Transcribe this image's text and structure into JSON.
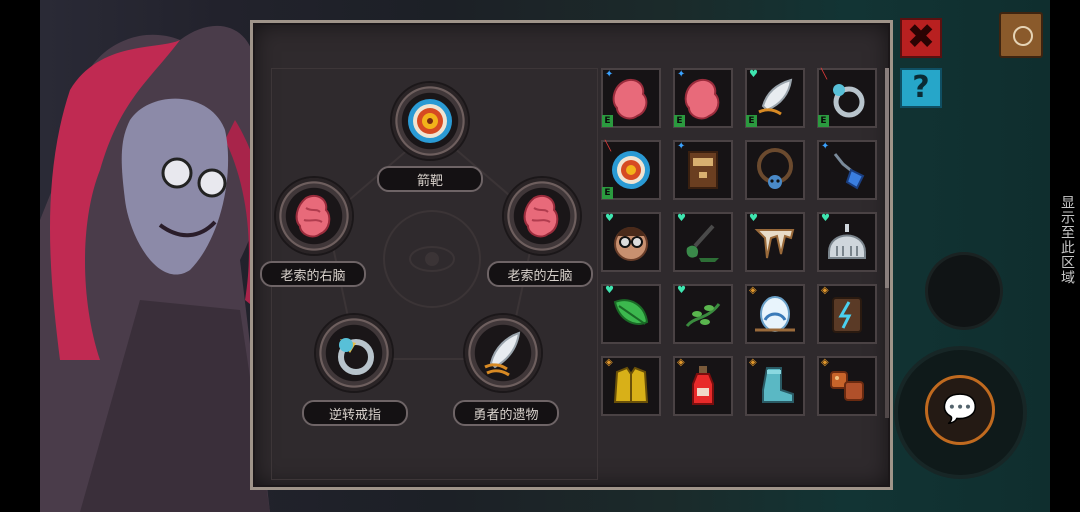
{
  "equipment": {
    "top": {
      "label": "箭靶",
      "icon": "target-icon"
    },
    "right_brain": {
      "label": "老索的右脑",
      "icon": "brain-icon"
    },
    "left_brain": {
      "label": "老索的左脑",
      "icon": "brain-icon"
    },
    "ring": {
      "label": "逆转戒指",
      "icon": "ring-icon"
    },
    "relic": {
      "label": "勇者的遗物",
      "icon": "feather-relic-icon"
    }
  },
  "inventory": [
    {
      "icon": "brain-icon",
      "marker": "star",
      "tag": "E"
    },
    {
      "icon": "brain-icon",
      "marker": "star",
      "tag": "E"
    },
    {
      "icon": "feather-relic-icon",
      "marker": "heart",
      "tag": "E"
    },
    {
      "icon": "ring-icon",
      "marker": "slash",
      "tag": "E"
    },
    {
      "icon": "target-icon",
      "marker": "slash",
      "tag": "E"
    },
    {
      "icon": "scroll-box-icon",
      "marker": "star",
      "tag": ""
    },
    {
      "icon": "skull-necklace-icon",
      "marker": "",
      "tag": ""
    },
    {
      "icon": "blue-amulet-icon",
      "marker": "star",
      "tag": ""
    },
    {
      "icon": "glasses-face-icon",
      "marker": "heart",
      "tag": ""
    },
    {
      "icon": "shovel-icon",
      "marker": "heart",
      "tag": ""
    },
    {
      "icon": "bone-fang-icon",
      "marker": "heart",
      "tag": ""
    },
    {
      "icon": "silver-helmet-icon",
      "marker": "heart",
      "tag": ""
    },
    {
      "icon": "green-leaf-icon",
      "marker": "heart",
      "tag": ""
    },
    {
      "icon": "vine-sprout-icon",
      "marker": "heart",
      "tag": ""
    },
    {
      "icon": "crystal-egg-icon",
      "marker": "shield",
      "tag": ""
    },
    {
      "icon": "lightning-rune-icon",
      "marker": "shield",
      "tag": ""
    },
    {
      "icon": "gold-armor-icon",
      "marker": "shield",
      "tag": ""
    },
    {
      "icon": "red-potion-icon",
      "marker": "shield",
      "tag": ""
    },
    {
      "icon": "teal-boot-icon",
      "marker": "shield",
      "tag": ""
    },
    {
      "icon": "meat-chunks-icon",
      "marker": "shield",
      "tag": ""
    }
  ],
  "buttons": {
    "close_glyph": "✖",
    "help_glyph": "?",
    "chat_glyph": "💬"
  },
  "side_text": "显示至此区域",
  "colors": {
    "panel_border": "#9f9489",
    "panel_bg": "#2f2a2d",
    "close_red": "#b82020",
    "help_cyan": "#26a6c9",
    "tag_green": "#2b9a3f"
  }
}
